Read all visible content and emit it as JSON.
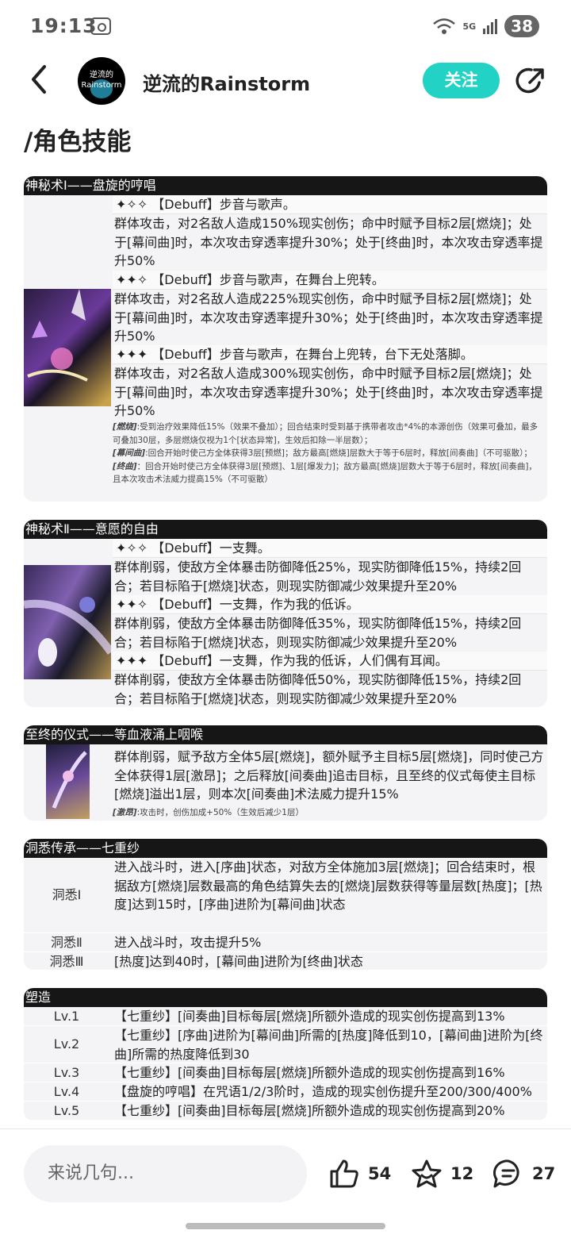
{
  "status_bar": {
    "time": "19:13",
    "network": "5G",
    "battery": "38"
  },
  "header": {
    "author": "逆流的Rainstorm",
    "avatar_text_line1": "逆流的",
    "avatar_text_line2": "Rainstorm",
    "follow_label": "关注"
  },
  "page_title": "/角色技能",
  "s1": {
    "title": "神秘术Ⅰ——盘旋的哼唱",
    "t1h": "✦✧✧ 【Debuff】步音与歌声。",
    "t1b": "群体攻击，对2名敌人造成150%现实创伤；命中时赋予目标2层[燃烧]；处于[幕间曲]时，本次攻击穿透率提升30%；处于[终曲]时，本次攻击穿透率提升50%",
    "t2h": "✦✦✧ 【Debuff】步音与歌声，在舞台上兜转。",
    "t2b": "群体攻击，对2名敌人造成225%现实创伤，命中时赋予目标2层[燃烧]；处于[幕间曲]时，本次攻击穿透率提升30%；处于[终曲]时，本次攻击穿透率提升50%",
    "t3h": "✦✦✦ 【Debuff】步音与歌声，在舞台上兜转，台下无处落脚。",
    "t3b": "群体攻击，对2名敌人造成300%现实创伤，命中时赋予目标2层[燃烧]；处于[幕间曲]时，本次攻击穿透率提升30%；处于[终曲]时，本次攻击穿透率提升50%",
    "n1k": "[燃烧]",
    "n1": ":受到治疗效果降低15%（效果不叠加）；回合结束时受到基于携带者攻击*4%的本源创伤（效果可叠加，最多可叠加30层，多层燃烧仅视为1个[状态异常]，生效后扣除一半层数）；",
    "n2k": "[幕间曲]",
    "n2": ":回合开始时使己方全体获得3层[预燃]；敌方最高[燃烧]层数大于等于6层时，释放[间奏曲]（不可驱散）；",
    "n3k": "[终曲]",
    "n3": "：回合开始时使己方全体获得3层[预燃]、1层[爆发力]；敌方最高[燃烧]层数大于等于6层时，释放[间奏曲]，且本次攻击术法威力提高15%（不可驱散）"
  },
  "s2": {
    "title": "神秘术Ⅱ——意愿的自由",
    "t1h": "✦✧✧ 【Debuff】一支舞。",
    "t1b": "群体削弱，使敌方全体暴击防御降低25%，现实防御降低15%，持续2回合；若目标陷于[燃烧]状态，则现实防御减少效果提升至20%",
    "t2h": "✦✦✧ 【Debuff】一支舞，作为我的低诉。",
    "t2b": "群体削弱，使敌方全体暴击防御降低35%，现实防御降低15%，持续2回合；若目标陷于[燃烧]状态，则现实防御减少效果提升至20%",
    "t3h": "✦✦✦ 【Debuff】一支舞，作为我的低诉，人们偶有耳闻。",
    "t3b": "群体削弱，使敌方全体暴击防御降低50%，现实防御降低15%，持续2回合；若目标陷于[燃烧]状态，则现实防御减少效果提升至20%"
  },
  "s3": {
    "title": "至终的仪式——等血液涌上咽喉",
    "body": "群体削弱，赋予敌方全体5层[燃烧]，额外赋予主目标5层[燃烧]，同时使己方全体获得1层[激昂]；之后释放[间奏曲]追击目标，且至终的仪式每使主目标[燃烧]溢出1层，则本次[间奏曲]术法威力提升15%",
    "nk": "[激昂]",
    "n": ":攻击时，创伤加成+50%（生效后减少1层）"
  },
  "s4": {
    "title": "洞悉传承——七重纱",
    "rows": [
      {
        "label": "洞悉Ⅰ",
        "text": "进入战斗时，进入[序曲]状态，对敌方全体施加3层[燃烧]；回合结束时，根据敌方[燃烧]层数最高的角色结算失去的[燃烧]层数获得等量层数[热度]；[热度]达到15时，[序曲]进阶为[幕间曲]状态"
      },
      {
        "label": "洞悉Ⅱ",
        "text": "进入战斗时，攻击提升5%"
      },
      {
        "label": "洞悉Ⅲ",
        "text": "[热度]达到40时，[幕间曲]进阶为[终曲]状态"
      }
    ]
  },
  "s5": {
    "title": "塑造",
    "rows": [
      {
        "label": "Lv.1",
        "text": "【七重纱】[间奏曲]目标每层[燃烧]所额外造成的现实创伤提高到13%"
      },
      {
        "label": "Lv.2",
        "text": "【七重纱】[序曲]进阶为[幕间曲]所需的[热度]降低到10，[幕间曲]进阶为[终曲]所需的热度降低到30"
      },
      {
        "label": "Lv.3",
        "text": "【七重纱】[间奏曲]目标每层[燃烧]所额外造成的现实创伤提高到16%"
      },
      {
        "label": "Lv.4",
        "text": "【盘旋的哼唱】在咒语1/2/3阶时，造成的现实创伤提升至200/300/400%"
      },
      {
        "label": "Lv.5",
        "text": "【七重纱】[间奏曲]目标每层[燃烧]所额外造成的现实创伤提高到20%"
      }
    ]
  },
  "bottom": {
    "comment_placeholder": "来说几句...",
    "likes": "54",
    "favorites": "12",
    "comments": "27"
  },
  "colors": {
    "accent": "#22d3c5",
    "section_header": "#161616"
  }
}
